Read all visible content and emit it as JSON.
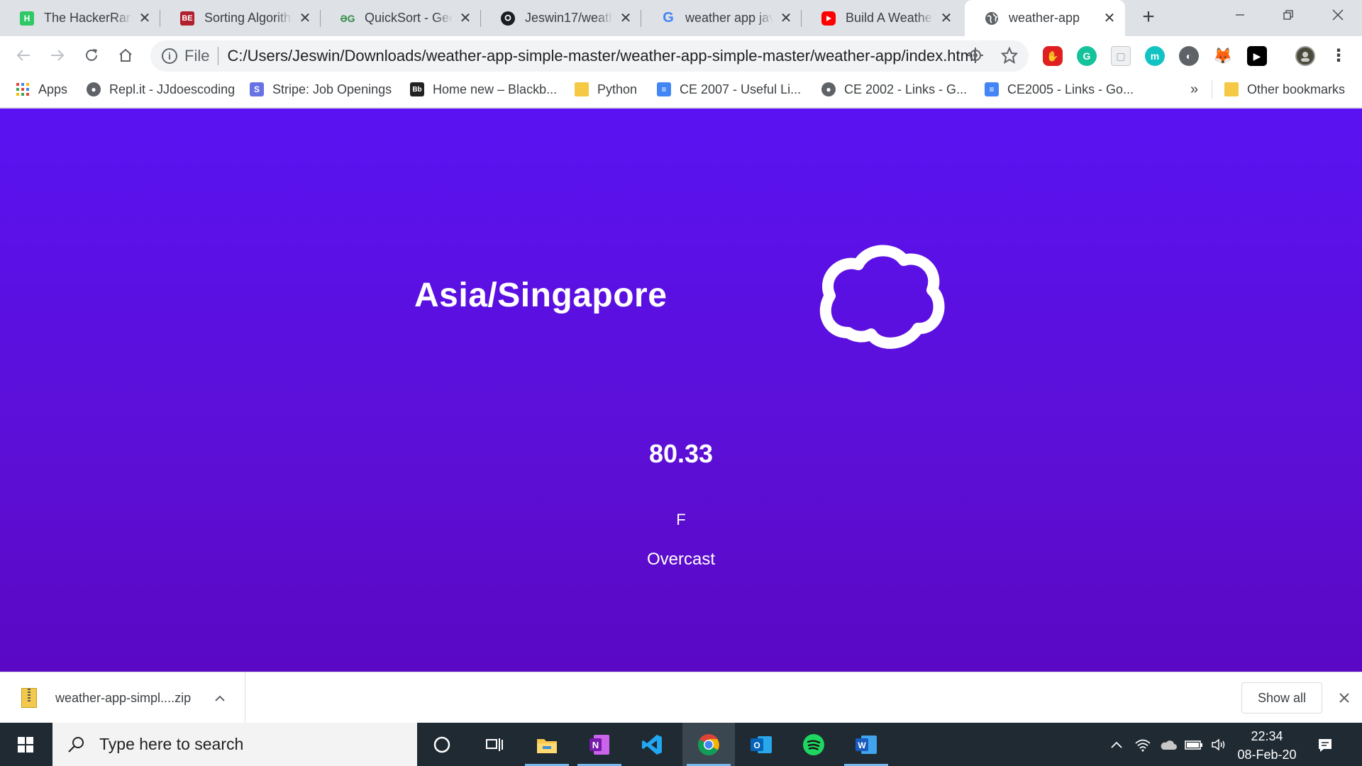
{
  "browser": {
    "tabs": [
      {
        "title": "The HackerRank",
        "icon": "hackerrank-icon",
        "color": "#2ec866",
        "glyph": "H",
        "x": 0
      },
      {
        "title": "Sorting Algorith",
        "icon": "bigocheatsheet-icon",
        "color": "#b0202e",
        "glyph": "BE",
        "x": 0
      },
      {
        "title": "QuickSort - Gee",
        "icon": "geeksforgeeks-icon",
        "color": "#2f8d46",
        "glyph": "GG",
        "x": 0
      },
      {
        "title": "Jeswin17/weath",
        "icon": "github-icon",
        "color": "#1b1f23",
        "glyph": "",
        "x": 0
      },
      {
        "title": "weather app jav",
        "icon": "google-icon",
        "color": "#4285f4",
        "glyph": "G",
        "x": 0
      },
      {
        "title": "Build A Weathe",
        "icon": "youtube-icon",
        "color": "#ff0000",
        "glyph": "",
        "x": 0
      },
      {
        "title": "weather-app",
        "icon": "globe-icon",
        "color": "#5f6368",
        "glyph": "",
        "x": 0,
        "active": true
      }
    ],
    "address": {
      "scheme": "File",
      "url": "C:/Users/Jeswin/Downloads/weather-app-simple-master/weather-app-simple-master/weather-app/index.html"
    },
    "bookmarks": [
      {
        "label": "Apps",
        "icon": "apps-grid-icon"
      },
      {
        "label": "Repl.it - JJdoescoding",
        "icon": "globe-icon"
      },
      {
        "label": "Stripe: Job Openings",
        "icon": "stripe-icon"
      },
      {
        "label": "Home new – Blackb...",
        "icon": "blackboard-icon"
      },
      {
        "label": "Python",
        "icon": "folder-icon"
      },
      {
        "label": "CE 2007 - Useful Li...",
        "icon": "google-docs-icon"
      },
      {
        "label": "CE 2002 - Links - G...",
        "icon": "globe-icon"
      },
      {
        "label": "CE2005 - Links - Go...",
        "icon": "google-docs-icon"
      }
    ],
    "bookmarks_overflow": "»",
    "other_bookmarks": "Other bookmarks"
  },
  "weather": {
    "timezone": "Asia/Singapore",
    "temperature": "80.33",
    "unit": "F",
    "summary": "Overcast",
    "icon": "cloud-icon",
    "background_top": "#5a12f2",
    "background_bottom": "#5a08c4"
  },
  "downloads": {
    "file_name": "weather-app-simpl....zip",
    "show_all": "Show all"
  },
  "taskbar": {
    "search_placeholder": "Type here to search",
    "time": "22:34",
    "date": "08-Feb-20"
  }
}
